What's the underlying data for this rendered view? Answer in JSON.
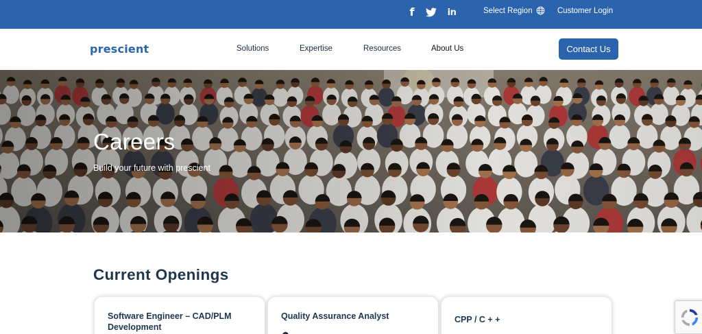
{
  "topbar": {
    "social": [
      "facebook-icon",
      "twitter-icon",
      "linkedin-icon"
    ],
    "region_label": "Select Region",
    "login_label": "Customer Login"
  },
  "nav": {
    "logo": "prescient",
    "items": [
      "Solutions",
      "Expertise",
      "Resources",
      "About Us"
    ],
    "contact_label": "Contact Us"
  },
  "hero": {
    "title": "Careers",
    "subtitle": "Build your future with prescient"
  },
  "openings": {
    "heading": "Current Openings",
    "cards": [
      {
        "title": "Software Engineer – CAD/PLM Development"
      },
      {
        "title": "Quality Assurance Analyst"
      },
      {
        "title": "CPP / C + +"
      }
    ]
  },
  "colors": {
    "brand": "#2b64ad",
    "heading": "#1e3550"
  }
}
